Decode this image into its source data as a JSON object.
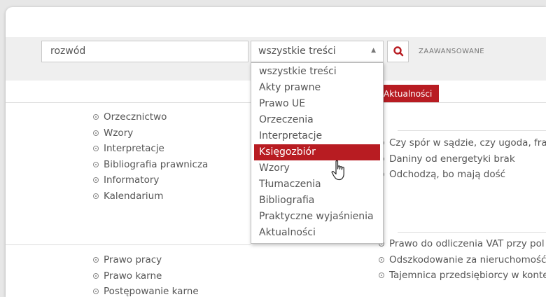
{
  "search": {
    "query": "rozwód",
    "scope_selected": "wszystkie treści",
    "advanced_label": "ZAAWANSOWANE"
  },
  "dropdown": {
    "options": [
      "wszystkie treści",
      "Akty prawne",
      "Prawo UE",
      "Orzeczenia",
      "Interpretacje",
      "Księgozbiór",
      "Wzory",
      "Tłumaczenia",
      "Bibliografia",
      "Praktyczne wyjaśnienia",
      "Aktualności"
    ],
    "highlighted": "Księgozbiór"
  },
  "tab": {
    "label": "Aktualności"
  },
  "left_links_top": [
    "Orzecznictwo",
    "Wzory",
    "Interpretacje",
    "Bibliografia prawnicza",
    "Informatory",
    "Kalendarium"
  ],
  "left_links_bottom": [
    "Prawo pracy",
    "Prawo karne",
    "Postępowanie karne"
  ],
  "news_top": [
    "Czy spór w sądzie, czy ugoda, fra",
    "Daniny od energetyki brak",
    "Odchodzą, bo mają dość"
  ],
  "news_bottom": [
    "Prawo do odliczenia VAT przy pol",
    "Odszkodowanie za nieruchomość",
    "Tajemnica przedsiębiorcy w konte"
  ],
  "colors": {
    "accent": "#b81c22",
    "toolbar": "#efefef",
    "text": "#555555"
  }
}
